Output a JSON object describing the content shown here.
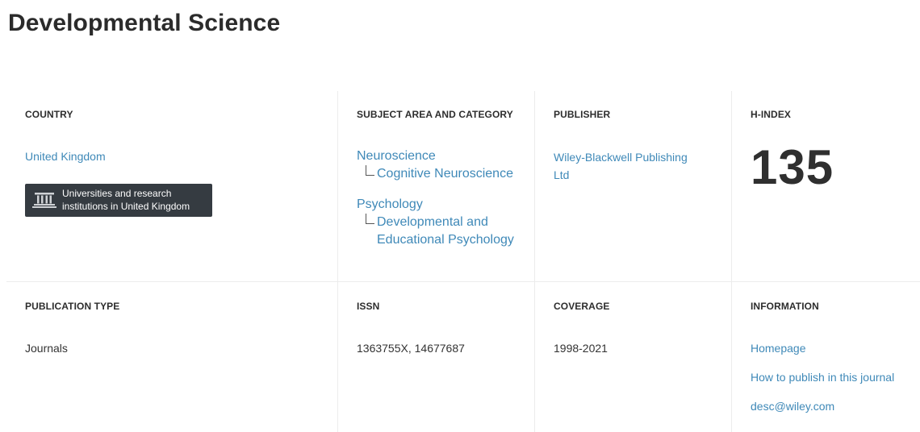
{
  "title": "Developmental Science",
  "country": {
    "label": "COUNTRY",
    "value": "United Kingdom",
    "institutions_button": "Universities and research institutions in United Kingdom",
    "icon": "institution-icon"
  },
  "subject": {
    "label": "SUBJECT AREA AND CATEGORY",
    "areas": [
      {
        "name": "Neuroscience",
        "categories": [
          "Cognitive Neuroscience"
        ]
      },
      {
        "name": "Psychology",
        "categories": [
          "Developmental and Educational Psychology"
        ]
      }
    ]
  },
  "publisher": {
    "label": "PUBLISHER",
    "value": "Wiley-Blackwell Publishing Ltd"
  },
  "hindex": {
    "label": "H-INDEX",
    "value": "135"
  },
  "publication_type": {
    "label": "PUBLICATION TYPE",
    "value": "Journals"
  },
  "issn": {
    "label": "ISSN",
    "value": "1363755X, 14677687"
  },
  "coverage": {
    "label": "COVERAGE",
    "value": "1998-2021"
  },
  "information": {
    "label": "INFORMATION",
    "links": [
      "Homepage",
      "How to publish in this journal",
      "desc@wiley.com"
    ]
  },
  "colors": {
    "link": "#3f89b8",
    "button_bg": "#353b41",
    "divider": "#ececec"
  }
}
